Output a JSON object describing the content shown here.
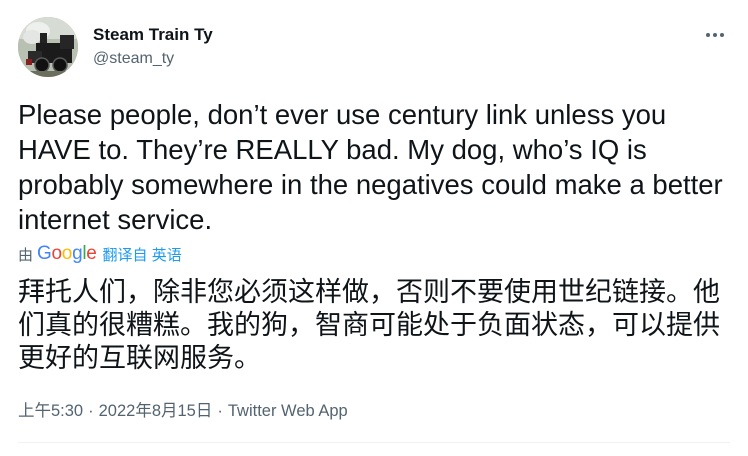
{
  "author": {
    "display_name": "Steam Train Ty",
    "handle": "@steam_ty"
  },
  "tweet": {
    "text": "Please people, don’t ever use century link unless you HAVE to. They’re REALLY bad. My dog, who’s IQ is probably somewhere in the negatives could make a better internet service."
  },
  "translation": {
    "by_label": "由",
    "provider": "Google",
    "provider_letter_colors": [
      "#4285f4",
      "#ea4335",
      "#fbbc05",
      "#4285f4",
      "#34a853",
      "#ea4335"
    ],
    "link_text": "翻译自 英语",
    "translated_text": "拜托人们，除非您必须这样做，否则不要使用世纪链接。他们真的很糟糕。我的狗，智商可能处于负面状态，可以提供更好的互联网服务。"
  },
  "meta": {
    "time": "上午5:30",
    "date": "2022年8月15日",
    "source": "Twitter Web App"
  },
  "colors": {
    "text": "#0f1419",
    "secondary": "#536471",
    "accent": "#1d9bf0"
  },
  "icons": {
    "more": "more-icon",
    "avatar": "steam-locomotive"
  }
}
